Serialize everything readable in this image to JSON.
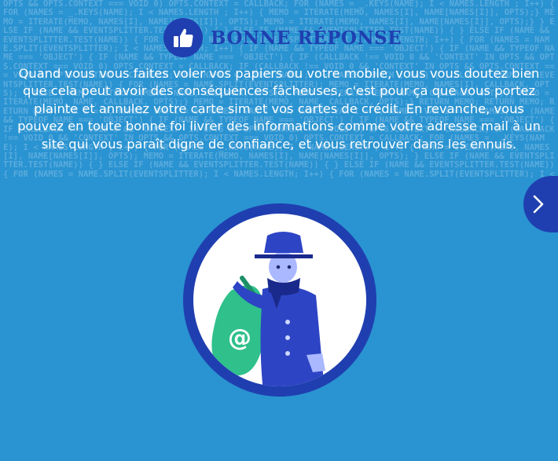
{
  "background_code": "OPTS && OPTS.CONTEXT === VOID 0) OPTS.CONTEXT = CALLBACK; FOR (NAMES = _.KEYS(NAME); I < NAMES.LENGTH ; I++) { FOR (NAMES = _.KEYS(NAME); I < NAMES.LENGTH ; I++) { MEMO = ITERATE(MEMO, NAMES[I], NAME[NAMES[I]], OPTS);} MEMO = ITERATE(MEMO, NAMES[I], NAME[NAMES[I]], OPTS); MEMO = ITERATE(MEMO, NAMES[I], NAME[NAMES[I]], OPTS);} } ELSE IF (NAME && EVENTSPLITTER.TEST(NAME)) { } ELSE IF (NAME && EVENTSPLITTER.TEST(NAME)) { } ELSE IF (NAME && EVENTSPLITTER.TEST(NAME)) { FOR (NAMES = NAME.SPLIT(EVENTSPLITTER); I < NAMES.LENGTH; I++) { FOR (NAMES = NAME.SPLIT(EVENTSPLITTER); I < NAMES.LENGTH; I++) { IF (NAME && TYPEOF NAME === 'OBJECT') { IF (NAME && TYPEOF NAME === 'OBJECT') { IF (NAME && TYPEOF NAME === 'OBJECT') { IF (CALLBACK !== VOID 0 && 'CONTEXT' IN OPTS && OPTS.CONTEXT === VOID 0) OPTS.CONTEXT = CALLBACK; IF (CALLBACK !== VOID 0 && 'CONTEXT' IN OPTS && OPTS.CONTEXT === VOID 0) OPTS.CONTEXT = CALLBACK; FOR (NAMES = _.KEYS(NAME); I < NAMES.LENGTH ; I++) { } ELSE IF (NAME && EVENTSPLITTER.TEST(NAME)) { FOR (NAMES = NAME.SPLIT(EVENTSPLITTER); MEMO = ITERATE(MEMO, NAMES[I], CALLBACK, OPTS); } ELSE { MEMO = ITERATE(MEMO, NAME, CALLBACK, OPTS);} MEMO = ITERATE(MEMO, NAME, CALLBACK, OPTS);} MEMO = ITERATE(MEMO, NAME, CALLBACK, OPTS);} MEMO = ITERATE(MEMO, NAME, CALLBACK, OPTS);} RETURN MEMO; RETURN MEMO; RETURN MEMO; VAR I = 0, NAMES; VAR I = 0, NAMES; VAR I = 0, NAMES; VAR I = 0, NAMES; VAR I = 0, NAMES; IF (NAME && TYPEOF NAME === 'OBJECT') { IF (NAME && TYPEOF NAME === 'OBJECT') { IF (NAME && TYPEOF NAME === 'OBJECT') { IF (CALLBACK !== VOID 0 && 'CONTEXT' IN OPTS && OPTS.CONTEXT === VOID 0) OPTS.CONTEXT = CALLBACK; IF (CALLBACK !== VOID 0 && 'CONTEXT' IN OPTS && OPTS.CONTEXT === VOID 0) OPTS.CONTEXT = CALLBACK; FOR (NAMES = _.KEYS(NAME); I < NAMES.LENGTH ; I++) { FOR (NAMES = _.KEYS(NAME); I < NAMES.LENGTH ; I++) { MEMO = ITERATE(MEMO, NAMES[I], NAME[NAMES[I]], OPTS); MEMO = ITERATE(MEMO, NAMES[I], NAME[NAMES[I]], OPTS); } ELSE IF (NAME && EVENTSPLITTER.TEST(NAME)) { } ELSE IF (NAME && EVENTSPLITTER.TEST(NAME)) { } ELSE IF (NAME && EVENTSPLITTER.TEST(NAME)) { FOR (NAMES = NAME.SPLIT(EVENTSPLITTER); I < NAMES.LENGTH; I++) { FOR (NAMES = NAME.SPLIT(EVENTSPLITTER); I <",
  "header": {
    "title": "BONNE RÉPONSE",
    "icon": "thumbs-up-icon"
  },
  "answer_text": "Quand vous vous faites voler vos papiers ou votre mobile, vous vous doutez bien que cela peut avoir des conséquences fâcheuses, c'est pour ça que vous portez plainte et annulez votre carte sim et vos cartes de crédit. En revanche, vous pouvez en toute bonne foi livrer des informations comme votre adresse mail à un site qui vous paraît digne de confiance, et vous retrouver dans les ennuis.",
  "next_button": {
    "icon": "chevron-right-icon"
  },
  "illustration": {
    "icon": "thief-with-email-sack-icon",
    "sack_symbol": "@"
  },
  "colors": {
    "background": "#2a93d1",
    "accent": "#1f3fb0",
    "text": "#ffffff",
    "sack_green": "#2fc08b",
    "thief_blue": "#2d44c4"
  }
}
